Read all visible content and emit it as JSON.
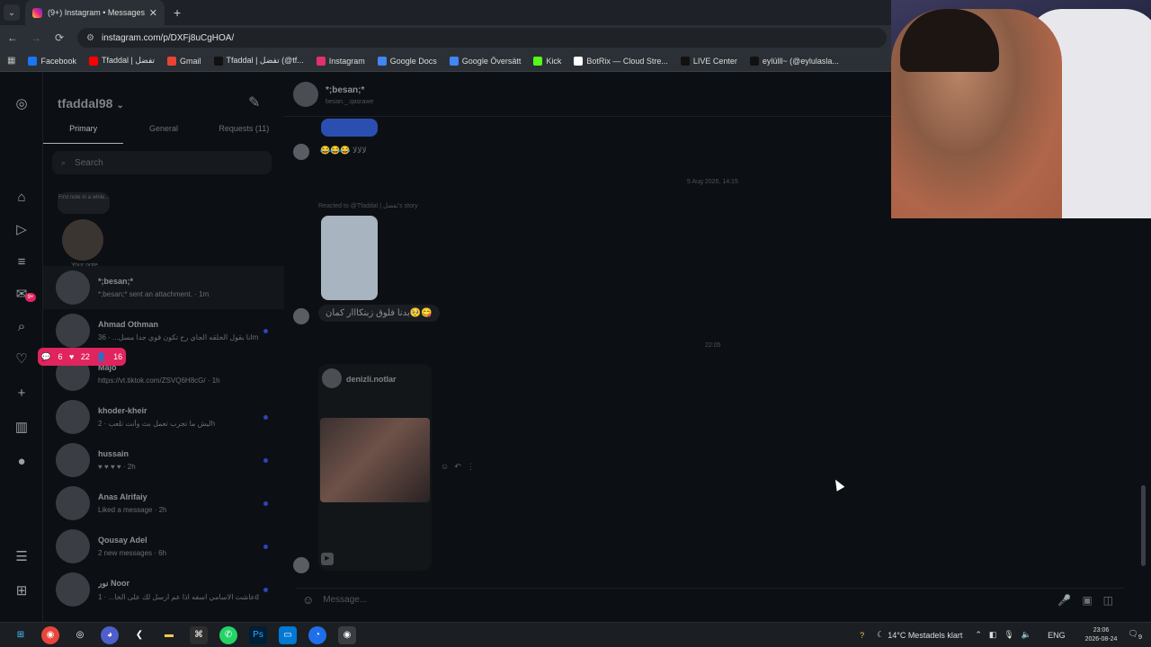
{
  "browser": {
    "tab_title": "(9+) Instagram • Messages",
    "url": "instagram.com/p/DXFj8uCgHOA/",
    "bookmarks": [
      {
        "label": "Facebook",
        "color": "#1877f2"
      },
      {
        "label": "Tfaddal | تفضل",
        "color": "#ff0000"
      },
      {
        "label": "Gmail",
        "color": "#ea4335"
      },
      {
        "label": "Tfaddal | تفضل (@tf...",
        "color": "#111111"
      },
      {
        "label": "Instagram",
        "color": "#e1306c"
      },
      {
        "label": "Google Docs",
        "color": "#4285f4"
      },
      {
        "label": "Google Översätt",
        "color": "#4285f4"
      },
      {
        "label": "Kick",
        "color": "#53fc18"
      },
      {
        "label": "BotRix — Cloud Stre...",
        "color": "#ffffff"
      },
      {
        "label": "LIVE Center",
        "color": "#111111"
      },
      {
        "label": "eylülll~ (@eylulasla...",
        "color": "#111111"
      }
    ]
  },
  "inbox": {
    "username": "tfaddal98",
    "tabs": [
      "Primary",
      "General",
      "Requests (11)"
    ],
    "search_placeholder": "Search",
    "note_text": "First note in a while...",
    "note_label": "Your note",
    "conversations": [
      {
        "name": "*;besan;*",
        "preview": "*;besan;* sent an attachment. · 1m",
        "dot": false
      },
      {
        "name": "Ahmad Othman",
        "preview": "انا بقول الحلقه الجاي رح تكون قوي جدا مسل... · 36m",
        "dot": true
      },
      {
        "name": "Majo",
        "preview": "https://vt.tiktok.com/ZSVQ6H8cG/ · 1h",
        "dot": false
      },
      {
        "name": "khoder-kheir",
        "preview": "ليش ما تجرب تعمل بث وأنت تلعب · 2h",
        "dot": true
      },
      {
        "name": "hussain",
        "preview": "♥ ♥ ♥ ♥ · 2h",
        "dot": true
      },
      {
        "name": "Anas Alrifaiy",
        "preview": "Liked a message · 2h",
        "dot": true
      },
      {
        "name": "Qousay Adel",
        "preview": "2 new messages · 6h",
        "dot": true
      },
      {
        "name": "نور Noor",
        "preview": "عاشت الاسامي اسفه اذا عم ارسل لك على الخا... · 1d",
        "dot": true
      }
    ],
    "stats": {
      "comments": "6",
      "likes": "22",
      "follows": "16"
    }
  },
  "chat": {
    "header_name": "*;besan;*",
    "header_handle": "besan._.qasrawe",
    "msg1": "😂😂😂 لالالا",
    "timestamp1": "5 Aug 2026, 14:15",
    "reacted_label": "Reacted to @Tfaddal | تفضل's story",
    "msg2": "بدنا فلوق زبنكااار كمان🥺😋",
    "timestamp2": "22:05",
    "shared_account": "denizli.notlar",
    "composer_placeholder": "Message..."
  },
  "taskbar": {
    "weather": "14°C  Mestadels klart",
    "lang": "ENG",
    "time": "23:06",
    "date": "2026-08-24",
    "notif_count": "9"
  }
}
